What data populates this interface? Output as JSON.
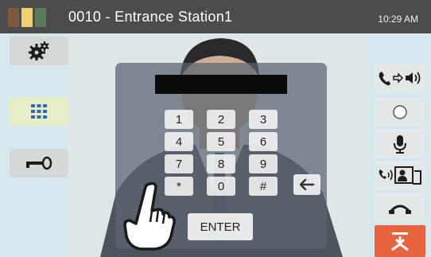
{
  "header": {
    "station_label": "0010 - Entrance Station1",
    "time": "10:29 AM",
    "status_colors": [
      "#7a5a3a",
      "#f0d070",
      "#5a7a5a"
    ]
  },
  "left_buttons": [
    {
      "icon": "settings-gear-icon"
    },
    {
      "icon": "keypad-grid-icon",
      "active": true
    },
    {
      "icon": "door-key-icon"
    }
  ],
  "keypad": {
    "display_value": "",
    "keys": [
      "1",
      "2",
      "3",
      "4",
      "5",
      "6",
      "7",
      "8",
      "9",
      "*",
      "0",
      "#"
    ],
    "backspace_icon": "arrow-left-icon",
    "enter_label": "ENTER"
  },
  "right_buttons": [
    {
      "icon": "talk-speaker-icon"
    },
    {
      "icon": "record-icon"
    },
    {
      "icon": "microphone-icon"
    },
    {
      "icon": "monitor-transfer-icon"
    },
    {
      "icon": "hang-up-icon"
    },
    {
      "icon": "door-release-icon"
    }
  ],
  "colors": {
    "accent_red": "#e8643e",
    "active_highlight": "#e8eec8",
    "icon_blue": "#2f6db3"
  }
}
